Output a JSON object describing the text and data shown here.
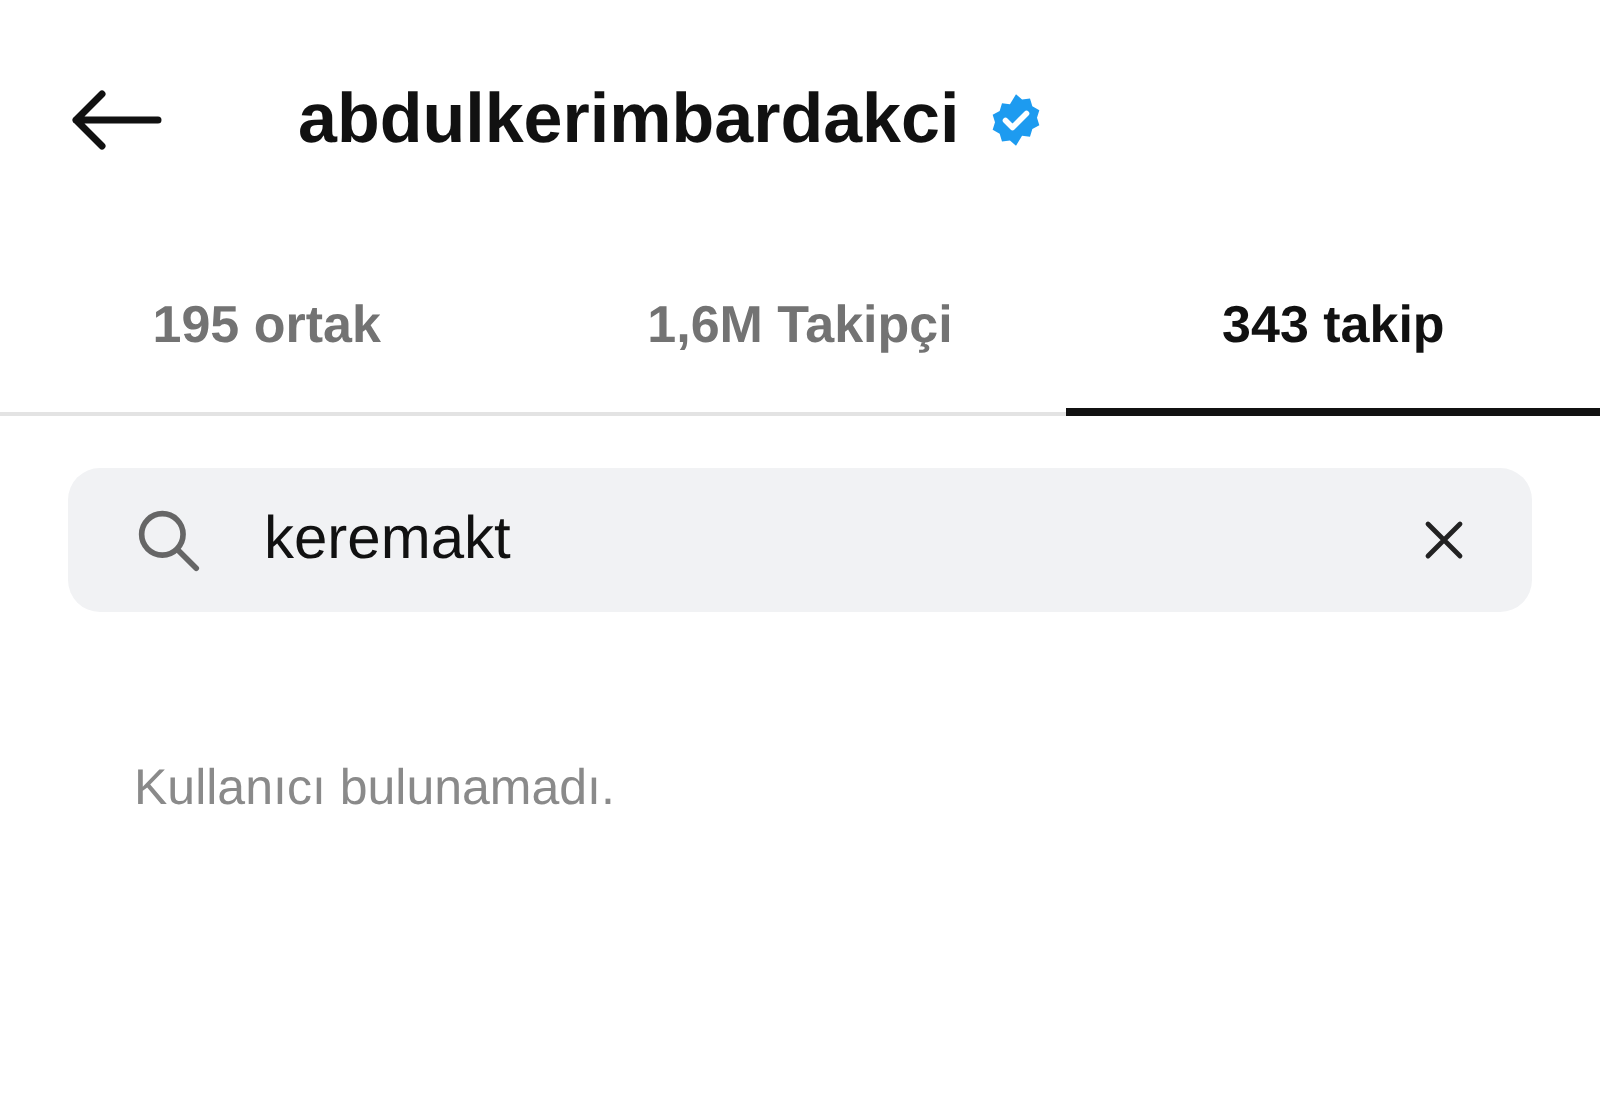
{
  "header": {
    "title": "abdulkerimbardakci",
    "verified": true
  },
  "tabs": [
    {
      "label": "195 ortak",
      "selected": false
    },
    {
      "label": "1,6M Takipçi",
      "selected": false
    },
    {
      "label": "343 takip",
      "selected": true
    }
  ],
  "search": {
    "value": "keremakt"
  },
  "message": "Kullanıcı bulunamadı."
}
